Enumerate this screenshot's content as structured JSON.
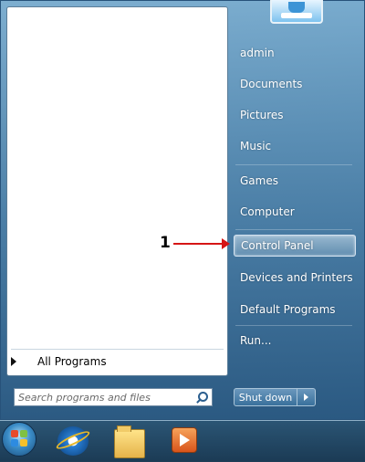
{
  "annotation": {
    "label": "1"
  },
  "left_pane": {
    "all_programs_label": "All Programs",
    "search": {
      "placeholder": "Search programs and files",
      "icon": "search-icon"
    }
  },
  "right_pane": {
    "items": [
      {
        "label": "admin"
      },
      {
        "label": "Documents"
      },
      {
        "label": "Pictures"
      },
      {
        "label": "Music"
      },
      {
        "label": "Games"
      },
      {
        "label": "Computer"
      },
      {
        "label": "Control Panel",
        "highlighted": true
      },
      {
        "label": "Devices and Printers"
      },
      {
        "label": "Default Programs"
      },
      {
        "label": "Run..."
      }
    ]
  },
  "shutdown": {
    "label": "Shut down",
    "options_icon": "chevron-right-icon"
  },
  "taskbar": {
    "items": [
      {
        "icon": "windows-start-icon"
      },
      {
        "icon": "internet-explorer-icon"
      },
      {
        "icon": "folder-icon"
      },
      {
        "icon": "media-player-icon"
      }
    ]
  },
  "colors": {
    "annotation_arrow": "#d61515",
    "accent": "#3d7aa8"
  }
}
